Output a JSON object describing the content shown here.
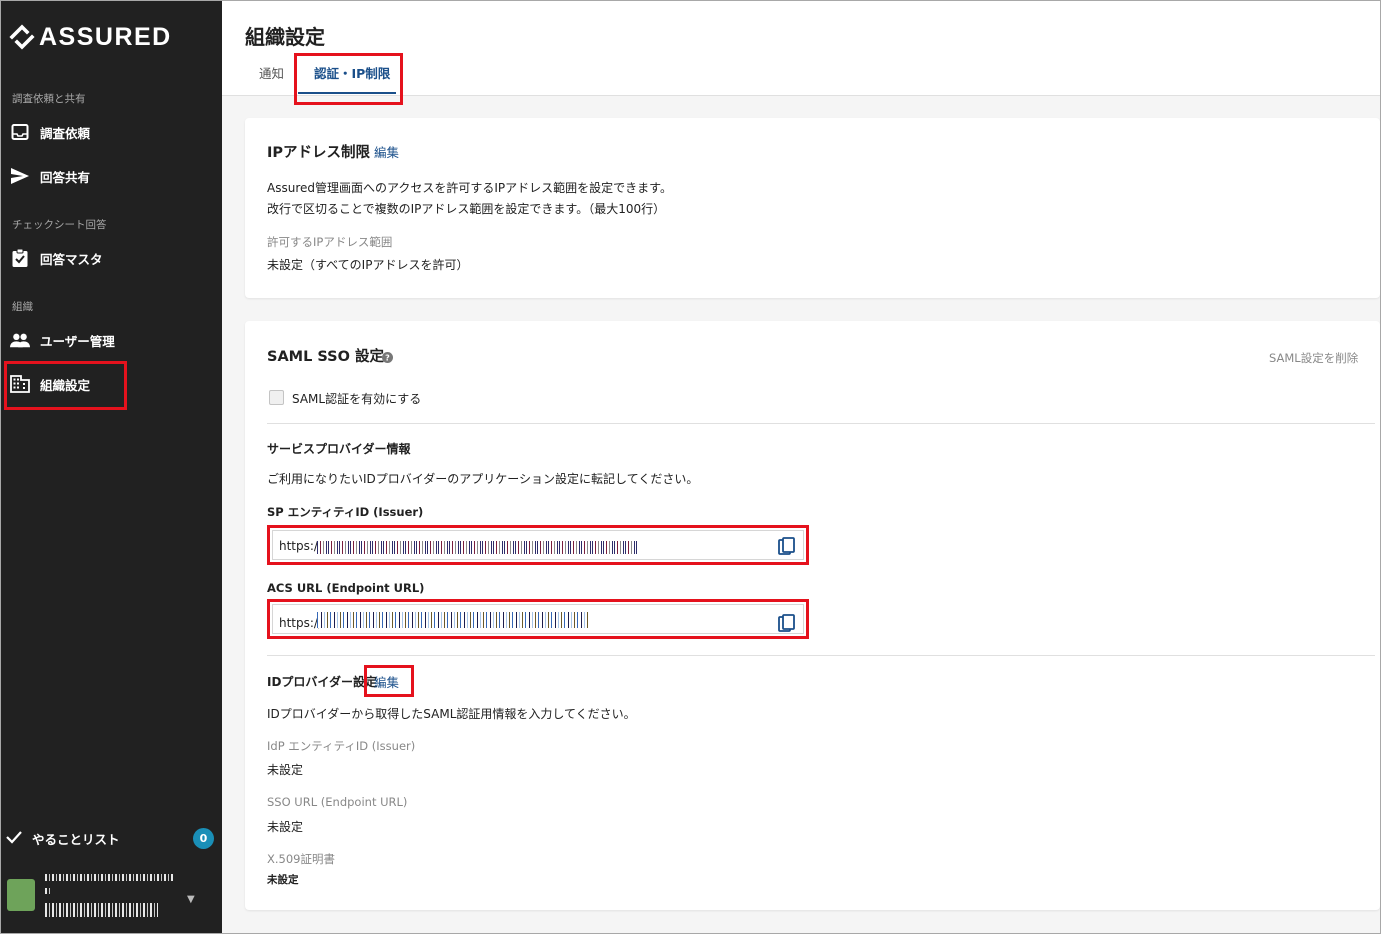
{
  "brand": {
    "name": "ASSURED"
  },
  "sidebar": {
    "sections": [
      {
        "label": "調査依頼と共有"
      },
      {
        "label": "チェックシート回答"
      },
      {
        "label": "組織"
      }
    ],
    "items": [
      {
        "label": "調査依頼",
        "icon": "inbox-icon"
      },
      {
        "label": "回答共有",
        "icon": "send-icon"
      },
      {
        "label": "回答マスタ",
        "icon": "clipboard-check-icon"
      },
      {
        "label": "ユーザー管理",
        "icon": "people-icon"
      },
      {
        "label": "組織設定",
        "icon": "building-icon",
        "active": true
      }
    ],
    "todo": {
      "label": "やることリスト",
      "count": "0"
    }
  },
  "header": {
    "title": "組織設定",
    "tabs": [
      {
        "label": "通知"
      },
      {
        "label": "認証・IP制限",
        "active": true
      }
    ]
  },
  "ip_restriction": {
    "title": "IPアドレス制限",
    "edit_label": "編集",
    "description_line1": "Assured管理画面へのアクセスを許可するIPアドレス範囲を設定できます。",
    "description_line2": "改行で区切ることで複数のIPアドレス範囲を設定できます。（最大100行）",
    "field_label": "許可するIPアドレス範囲",
    "field_value": "未設定（すべてのIPアドレスを許可）"
  },
  "saml": {
    "title": "SAML SSO 設定",
    "help_icon": "help-circle-icon",
    "delete_label": "SAML設定を削除",
    "enable_checkbox_label": "SAML認証を有効にする",
    "sp_section_title": "サービスプロバイダー情報",
    "sp_section_description": "ご利用になりたいIDプロバイダーのアプリケーション設定に転記してください。",
    "sp_entity_label": "SP エンティティID (Issuer)",
    "sp_entity_value": "https://",
    "acs_label": "ACS URL (Endpoint URL)",
    "acs_value": "https://",
    "idp_section_title": "IDプロバイダー設定",
    "idp_edit_label": "編集",
    "idp_description": "IDプロバイダーから取得したSAML認証用情報を入力してください。",
    "idp_entity_label": "IdP エンティティID (Issuer)",
    "idp_entity_value": "未設定",
    "sso_url_label": "SSO URL (Endpoint URL)",
    "sso_url_value": "未設定",
    "cert_label": "X.509証明書",
    "cert_value": "未設定"
  },
  "colors": {
    "sidebar_bg": "#212121",
    "accent": "#1a4f8a",
    "highlight": "#e5121d",
    "badge": "#1a8fb7"
  }
}
